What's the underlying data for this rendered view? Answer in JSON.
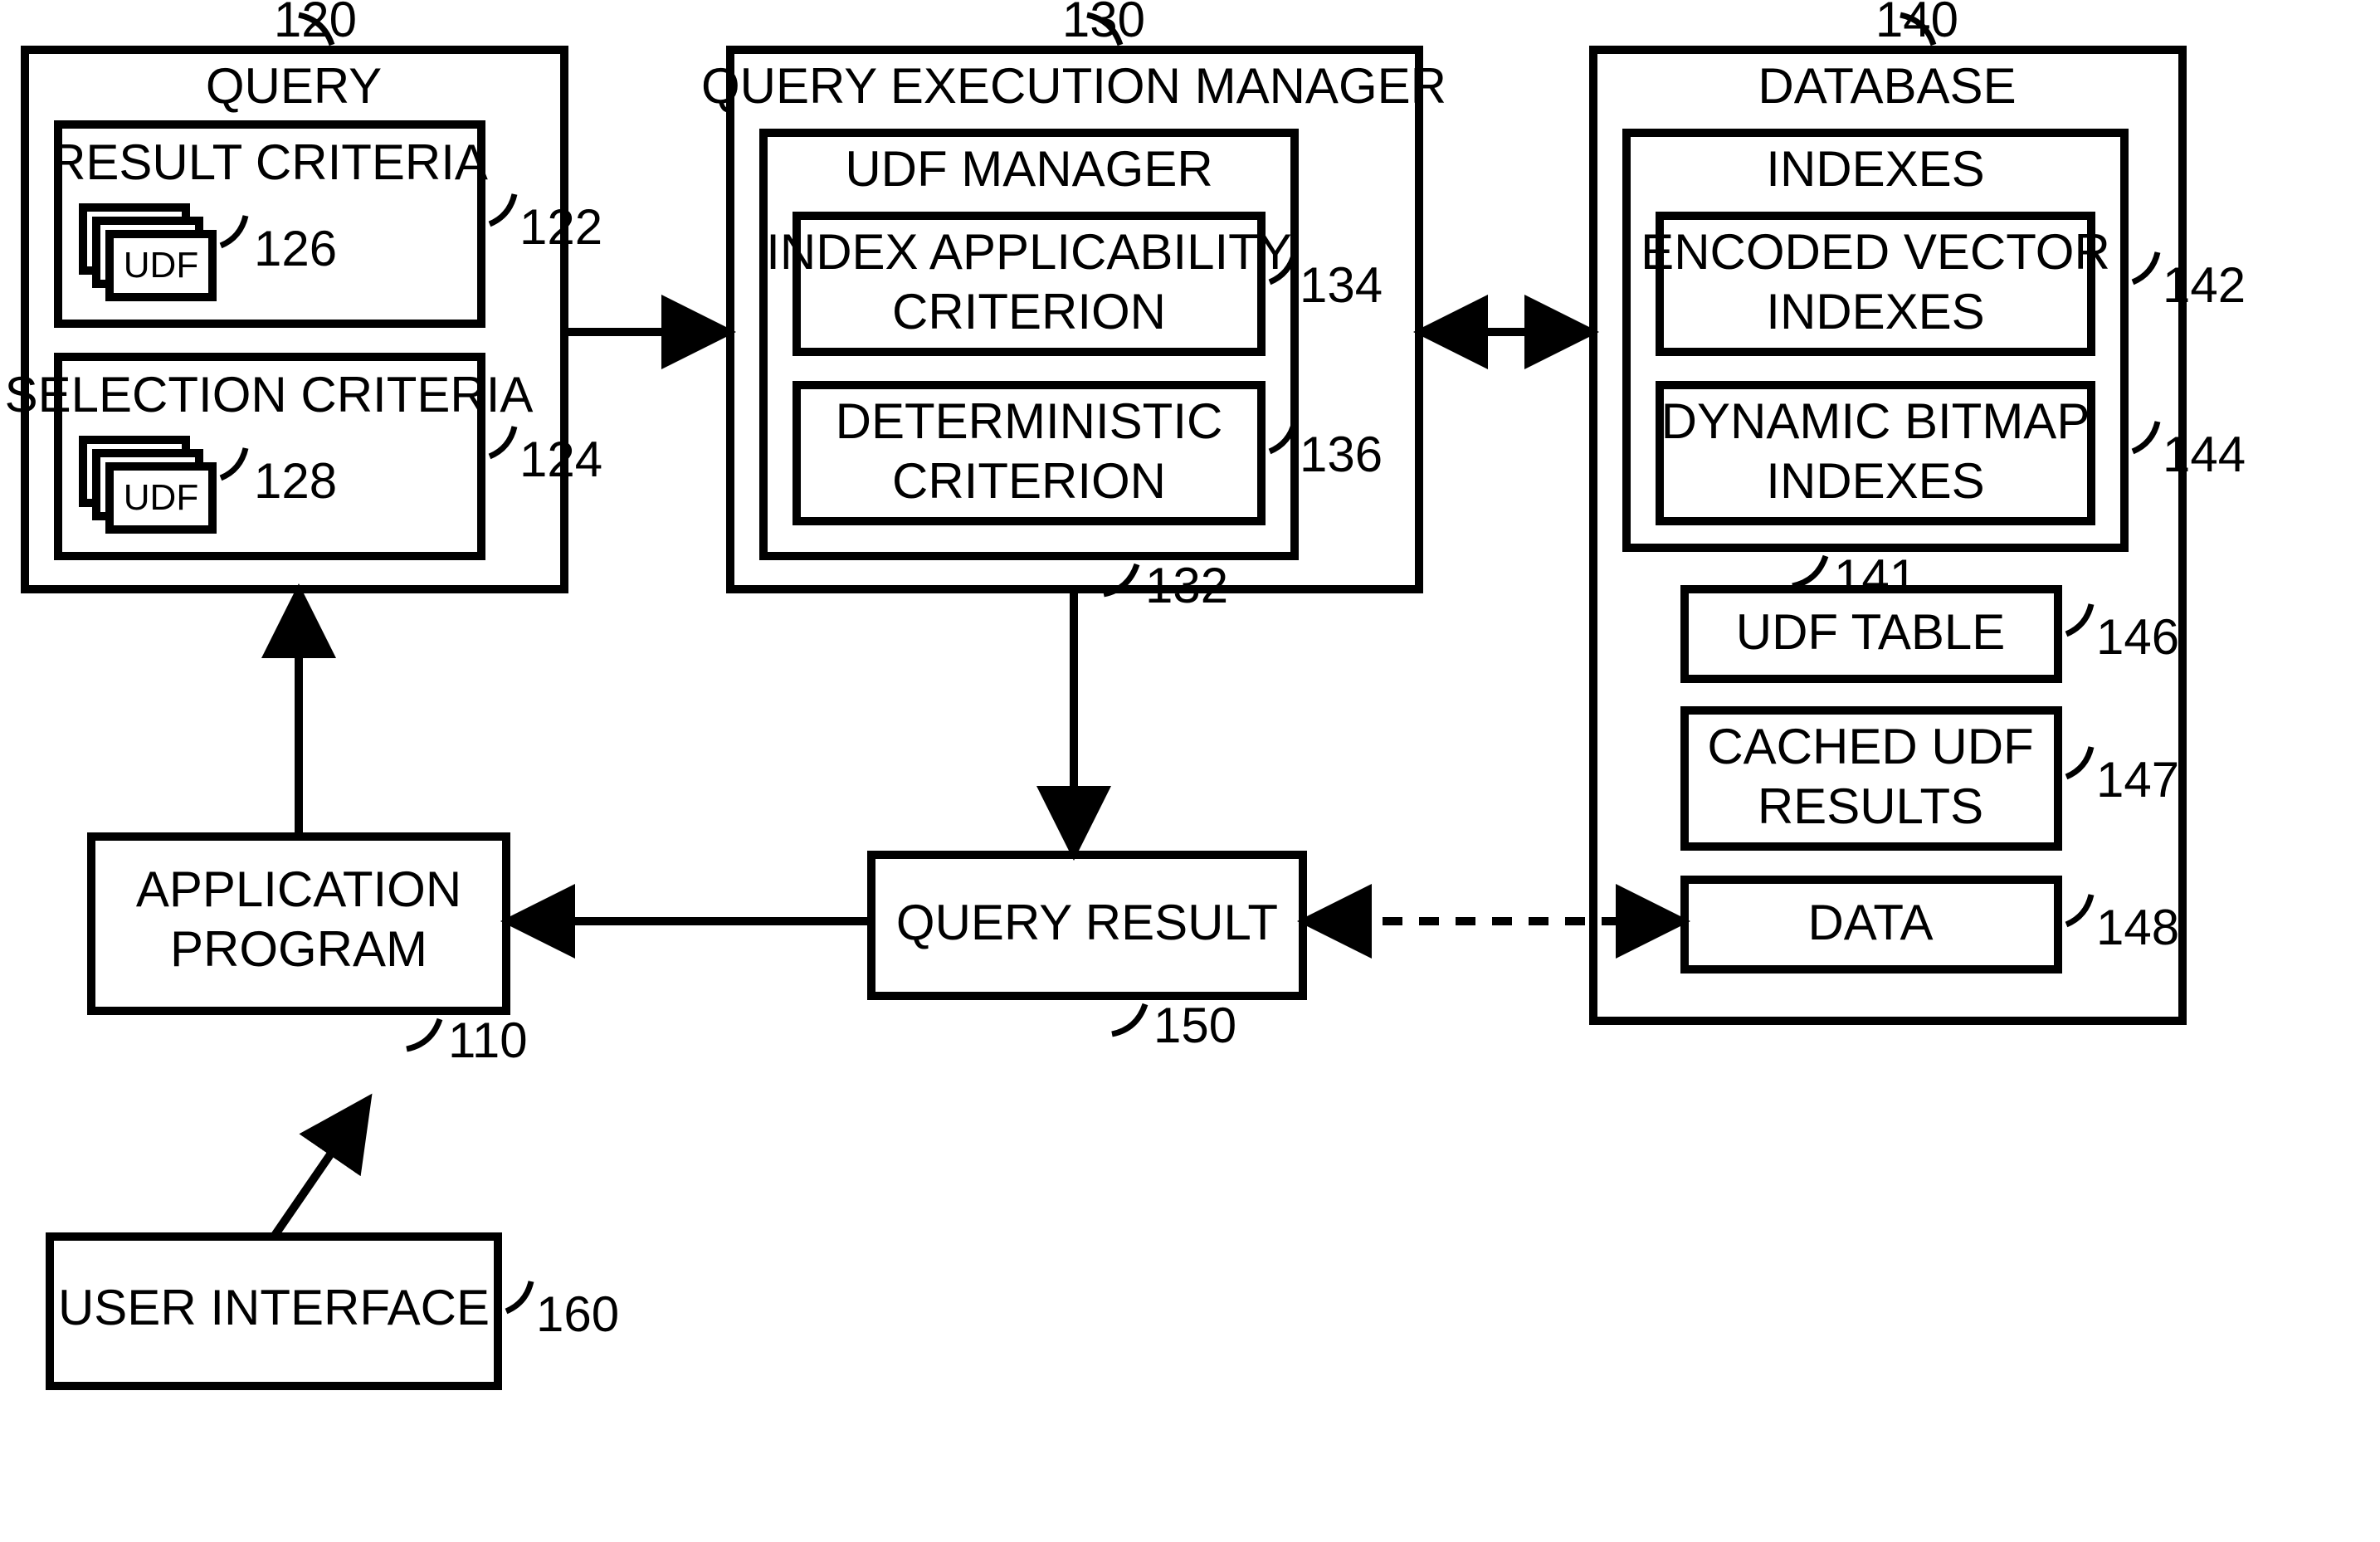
{
  "boxes": {
    "query": {
      "title": "QUERY",
      "ref": "120"
    },
    "result_criteria": {
      "title": "RESULT CRITERIA",
      "ref": "122",
      "udf": "UDF",
      "udf_ref": "126"
    },
    "selection_criteria": {
      "title": "SELECTION CRITERIA",
      "ref": "124",
      "udf": "UDF",
      "udf_ref": "128"
    },
    "qem": {
      "title": "QUERY EXECUTION MANAGER",
      "ref": "130"
    },
    "udf_manager": {
      "title": "UDF MANAGER",
      "ref": "132"
    },
    "index_applicability": {
      "title1": "INDEX APPLICABILITY",
      "title2": "CRITERION",
      "ref": "134"
    },
    "deterministic": {
      "title1": "DETERMINISTIC",
      "title2": "CRITERION",
      "ref": "136"
    },
    "database": {
      "title": "DATABASE",
      "ref": "140"
    },
    "indexes": {
      "title": "INDEXES",
      "ref": "141"
    },
    "evi": {
      "title1": "ENCODED VECTOR",
      "title2": "INDEXES",
      "ref": "142"
    },
    "dbi": {
      "title1": "DYNAMIC BITMAP",
      "title2": "INDEXES",
      "ref": "144"
    },
    "udf_table": {
      "title": "UDF TABLE",
      "ref": "146"
    },
    "cached": {
      "title1": "CACHED UDF",
      "title2": "RESULTS",
      "ref": "147"
    },
    "data": {
      "title": "DATA",
      "ref": "148"
    },
    "app": {
      "title1": "APPLICATION",
      "title2": "PROGRAM",
      "ref": "110"
    },
    "query_result": {
      "title": "QUERY RESULT",
      "ref": "150"
    },
    "ui": {
      "title": "USER INTERFACE",
      "ref": "160"
    }
  }
}
